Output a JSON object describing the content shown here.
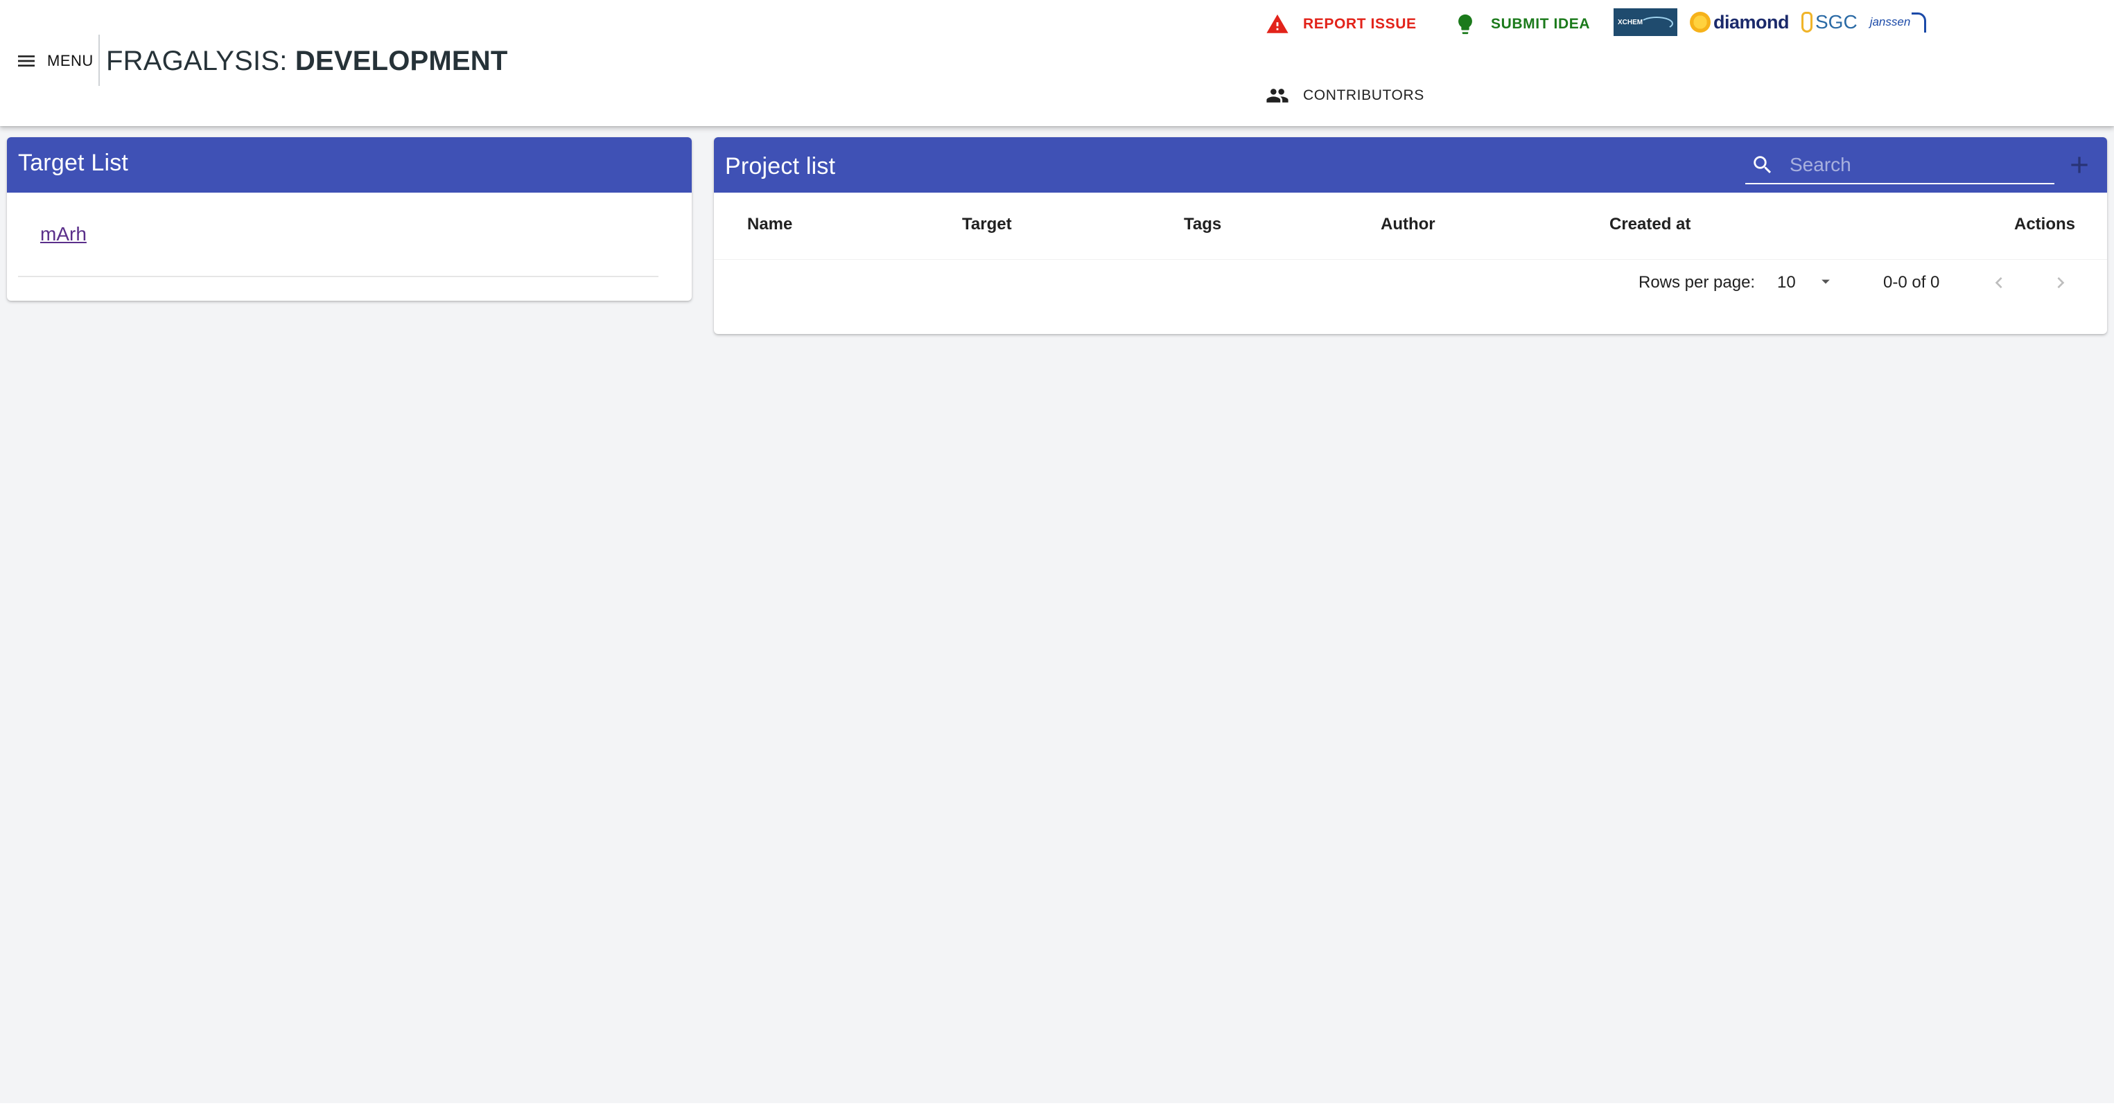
{
  "header": {
    "menu_label": "MENU",
    "title_prefix": "FRAGALYSIS: ",
    "title_env": "DEVELOPMENT",
    "report_issue": "REPORT ISSUE",
    "submit_idea": "SUBMIT IDEA",
    "contributors": "CONTRIBUTORS",
    "logos": {
      "xchem": "XCHEM",
      "diamond": "diamond",
      "sgc": "SGC",
      "janssen": "janssen"
    }
  },
  "target_list": {
    "title": "Target List",
    "items": [
      {
        "label": "mArh"
      }
    ]
  },
  "project_list": {
    "title": "Project list",
    "search_placeholder": "Search",
    "columns": [
      "Name",
      "Target",
      "Tags",
      "Author",
      "Created at",
      "Actions"
    ],
    "rows": [],
    "pagination": {
      "rows_per_page_label": "Rows per page:",
      "rows_per_page": "10",
      "range": "0-0 of 0"
    }
  },
  "colors": {
    "primary": "#3f51b5",
    "report": "#e2231a",
    "idea": "#1b7a1b",
    "background": "#f3f4f6",
    "link": "#5a2f8a"
  }
}
